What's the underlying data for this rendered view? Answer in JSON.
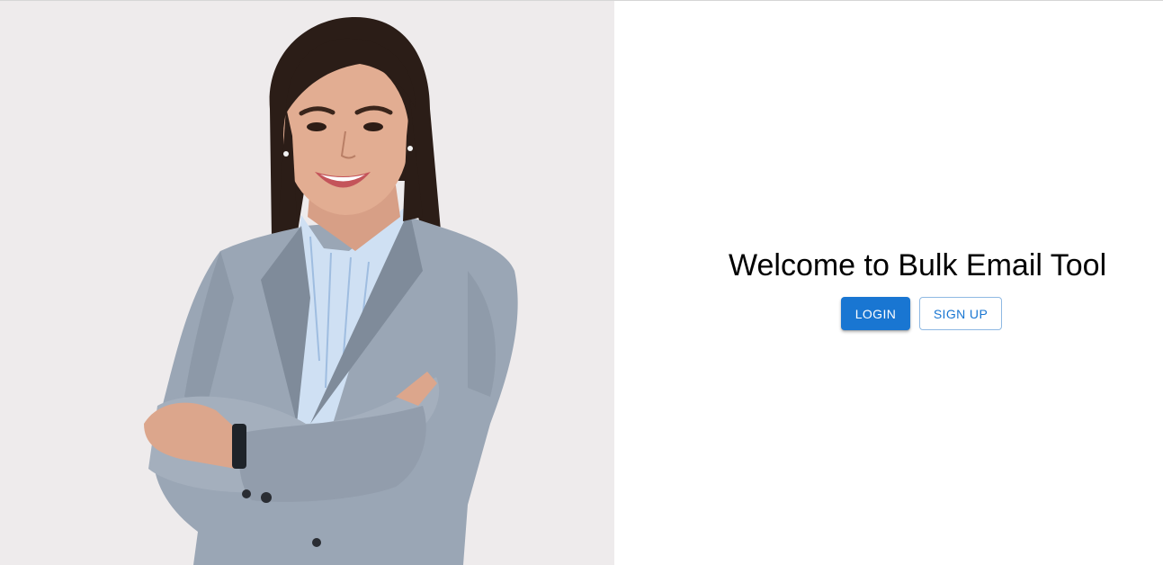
{
  "hero": {
    "image_alt": "smiling businesswoman with arms crossed"
  },
  "main": {
    "title": "Welcome to Bulk Email Tool",
    "login_label": "LOGIN",
    "signup_label": "SIGN UP"
  },
  "colors": {
    "primary": "#1976d2",
    "hero_background": "#eeebec"
  }
}
